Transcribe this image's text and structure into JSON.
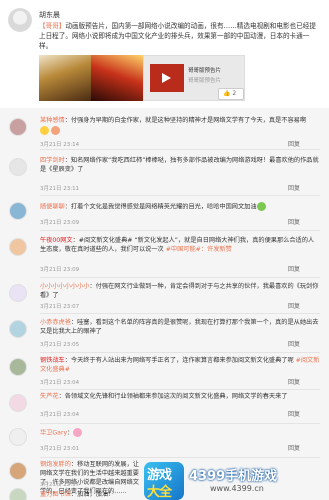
{
  "post": {
    "user": "胡东晨",
    "text_pre": "",
    "link": "【哥哥】",
    "text_body": "动画版预告片，国内第一部网络小说改编的动画，很有……精选电视剧和电影也已经提上日程了。网络小说即将成为中国文化产业的排头兵，效果第一部的中国动漫，日本的卡通一样。",
    "video_title": "哥哥版预告片",
    "video_sub": "哥哥版预告片",
    "like_count": "2"
  },
  "comments": [
    {
      "name": "某种感情",
      "text": "：付强身为早期的白金作家，就是这种坚持的精神才是网络文学有了今天，真是不容易啊",
      "emoji": "",
      "time": "3月21日 23:14",
      "reply": "回复"
    },
    {
      "name": "四学剑时",
      "text": "：知名网络作家“我吃西红柿”棒棒哒，独有多部作品被改编为网络游戏呀！最喜欢他的作品就是《星辰变》了",
      "time": "3月21日 23:11",
      "reply": "回复"
    },
    {
      "name": "随便聊聊",
      "text": "：打着个文化是我觉得感觉是网络精英光耀的目光，哈哈中国网文加油",
      "time": "3月21日 23:09",
      "reply": "回复"
    },
    {
      "name": "午夜00网文",
      "text": "：#阅文新文化盛典# “新文化发起人”，就是自日网络大神们我，真的便果那么合适的人生态度，敬在真时道些的人，我们可以说一次",
      "extra": "#中国可能#：许发新赞",
      "time": "3月21日 23:09",
      "reply": "回复"
    },
    {
      "name": "小小小小小小小小",
      "text": "：付强在网文行业做到一种，肯定会得到对于与之共享的伙伴，我最喜欢的《玩剑你看》了",
      "time": "3月21日 23:07",
      "reply": "回复"
    },
    {
      "name": "小赤赤虎爸",
      "text": "：哇塞，看到这个名单的阵容真的是很赞呢，我现在打算打那个我第一个，真的是从她出去又是比我大上的眼神了",
      "time": "3月21日 23:05",
      "reply": "回复"
    },
    {
      "name": "钢铁战车",
      "text": "：今天终于有人站出来为网络写手正名了，连作家算言都来参加阅文新文化盛典了呢",
      "extra": "#阅文新文化盛典#",
      "time": "3月21日 23:04",
      "reply": "回复"
    },
    {
      "name": "失芦花",
      "text": "：各领域文化先锋和行业领袖都来参加这次的阅文新文化盛典，网络文学的春天来了",
      "time": "3月21日 23:04",
      "reply": "回复"
    },
    {
      "name": "华卫Gary",
      "text": "：",
      "time": "3月21日 23:01",
      "reply": "回复"
    },
    {
      "name": "钢炮发胖的",
      "text": "：移动互联网的发展，让网络文学在我们的生活中越来越重要了，许多网络小说都是改编自网络文学的，已经变了我们现在的……",
      "time": "3月21日 22:57",
      "reply": "回复"
    },
    {
      "name": "童力图书馆",
      "text": "：加油，加油！",
      "time": "",
      "reply": ""
    }
  ],
  "watermark": {
    "icon_top": "游戏",
    "icon_bottom": "大全",
    "brand": "4399手机游戏",
    "url": "www.4399.cn"
  },
  "colors": {
    "link": "#eb7350",
    "bg": "#f5f5f5",
    "muted": "#999999"
  }
}
